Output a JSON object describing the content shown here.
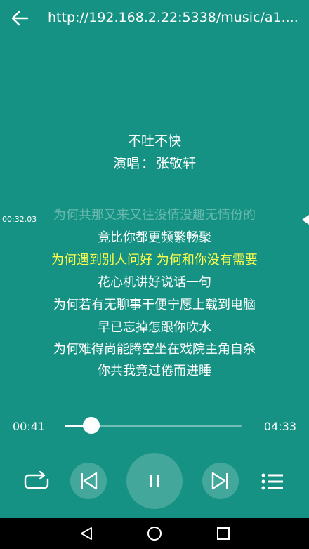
{
  "header": {
    "url": "http://192.168.2.22:5338/music/a1...."
  },
  "song": {
    "title": "不吐不快",
    "singer_prefix": "演唱",
    "singer_sep": "：",
    "singer": "张敬轩"
  },
  "lyrics": {
    "marker_time": "00:32.03",
    "lines": [
      "为何共那又来又往没情没趣无情份的",
      "竟比你都更频繁畅聚",
      "为何遇到别人问好 为何和你没有需要",
      "花心机讲好说话一句",
      "为何若有无聊事干便宁愿上载到电脑",
      "早已忘掉怎跟你吹水",
      "为何难得尚能腾空坐在戏院主角自杀",
      "你共我竟过倦而进睡"
    ],
    "active_index": 2
  },
  "player": {
    "current_time": "00:41",
    "total_time": "04:33",
    "progress": 0.15
  },
  "colors": {
    "background": "#159283",
    "active_lyric": "#ffff4d"
  },
  "icons": {
    "back": "back-arrow-icon",
    "repeat": "repeat-icon",
    "previous": "skip-previous-icon",
    "pause": "pause-icon",
    "next": "skip-next-icon",
    "playlist": "playlist-icon",
    "nav_back": "nav-back-icon",
    "nav_home": "nav-home-icon",
    "nav_recents": "nav-recents-icon"
  }
}
